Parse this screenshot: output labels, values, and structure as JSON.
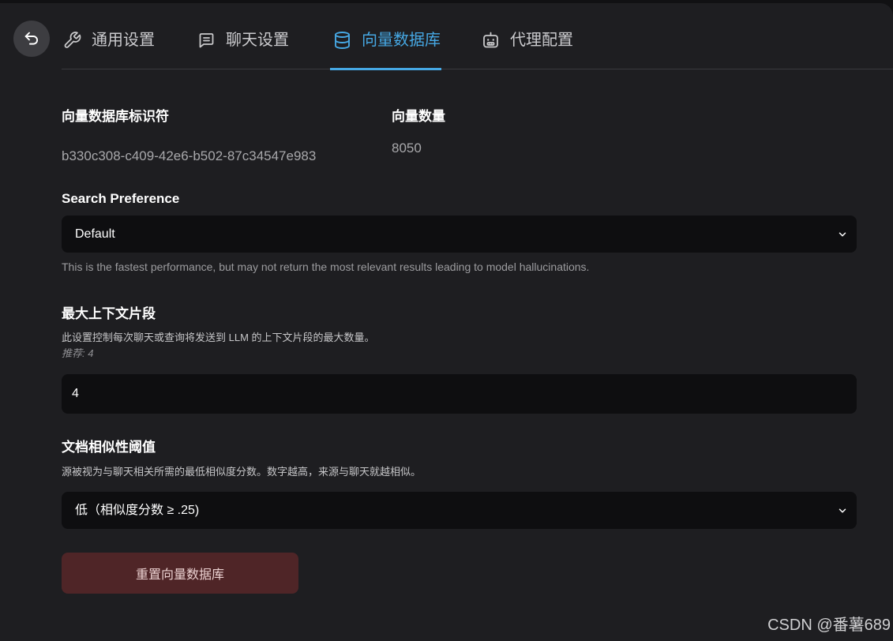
{
  "header": {
    "back_icon": "undo-arrow-icon",
    "tabs": [
      {
        "label": "通用设置",
        "icon": "wrench-icon",
        "active": false
      },
      {
        "label": "聊天设置",
        "icon": "chat-text-icon",
        "active": false
      },
      {
        "label": "向量数据库",
        "icon": "database-icon",
        "active": true
      },
      {
        "label": "代理配置",
        "icon": "robot-icon",
        "active": false
      }
    ]
  },
  "vector_db": {
    "identifier_label": "向量数据库标识符",
    "identifier_value": "b330c308-c409-42e6-b502-87c34547e983",
    "count_label": "向量数量",
    "count_value": "8050"
  },
  "search_preference": {
    "label": "Search Preference",
    "selected": "Default",
    "description": "This is the fastest performance, but may not return the most relevant results leading to model hallucinations."
  },
  "max_context": {
    "label": "最大上下文片段",
    "description": "此设置控制每次聊天或查询将发送到 LLM 的上下文片段的最大数量。",
    "recommendation": "推荐: 4",
    "value": "4"
  },
  "similarity": {
    "label": "文档相似性阈值",
    "description": "源被视为与聊天相关所需的最低相似度分数。数字越高，来源与聊天就越相似。",
    "selected": "低（相似度分数 ≥ .25)"
  },
  "reset_button": {
    "label": "重置向量数据库"
  },
  "watermark": "CSDN @番薯689",
  "colors": {
    "background": "#1e1e21",
    "field_background": "#0e0e10",
    "accent": "#46a8e4",
    "reset_button_background": "#4f2527"
  }
}
